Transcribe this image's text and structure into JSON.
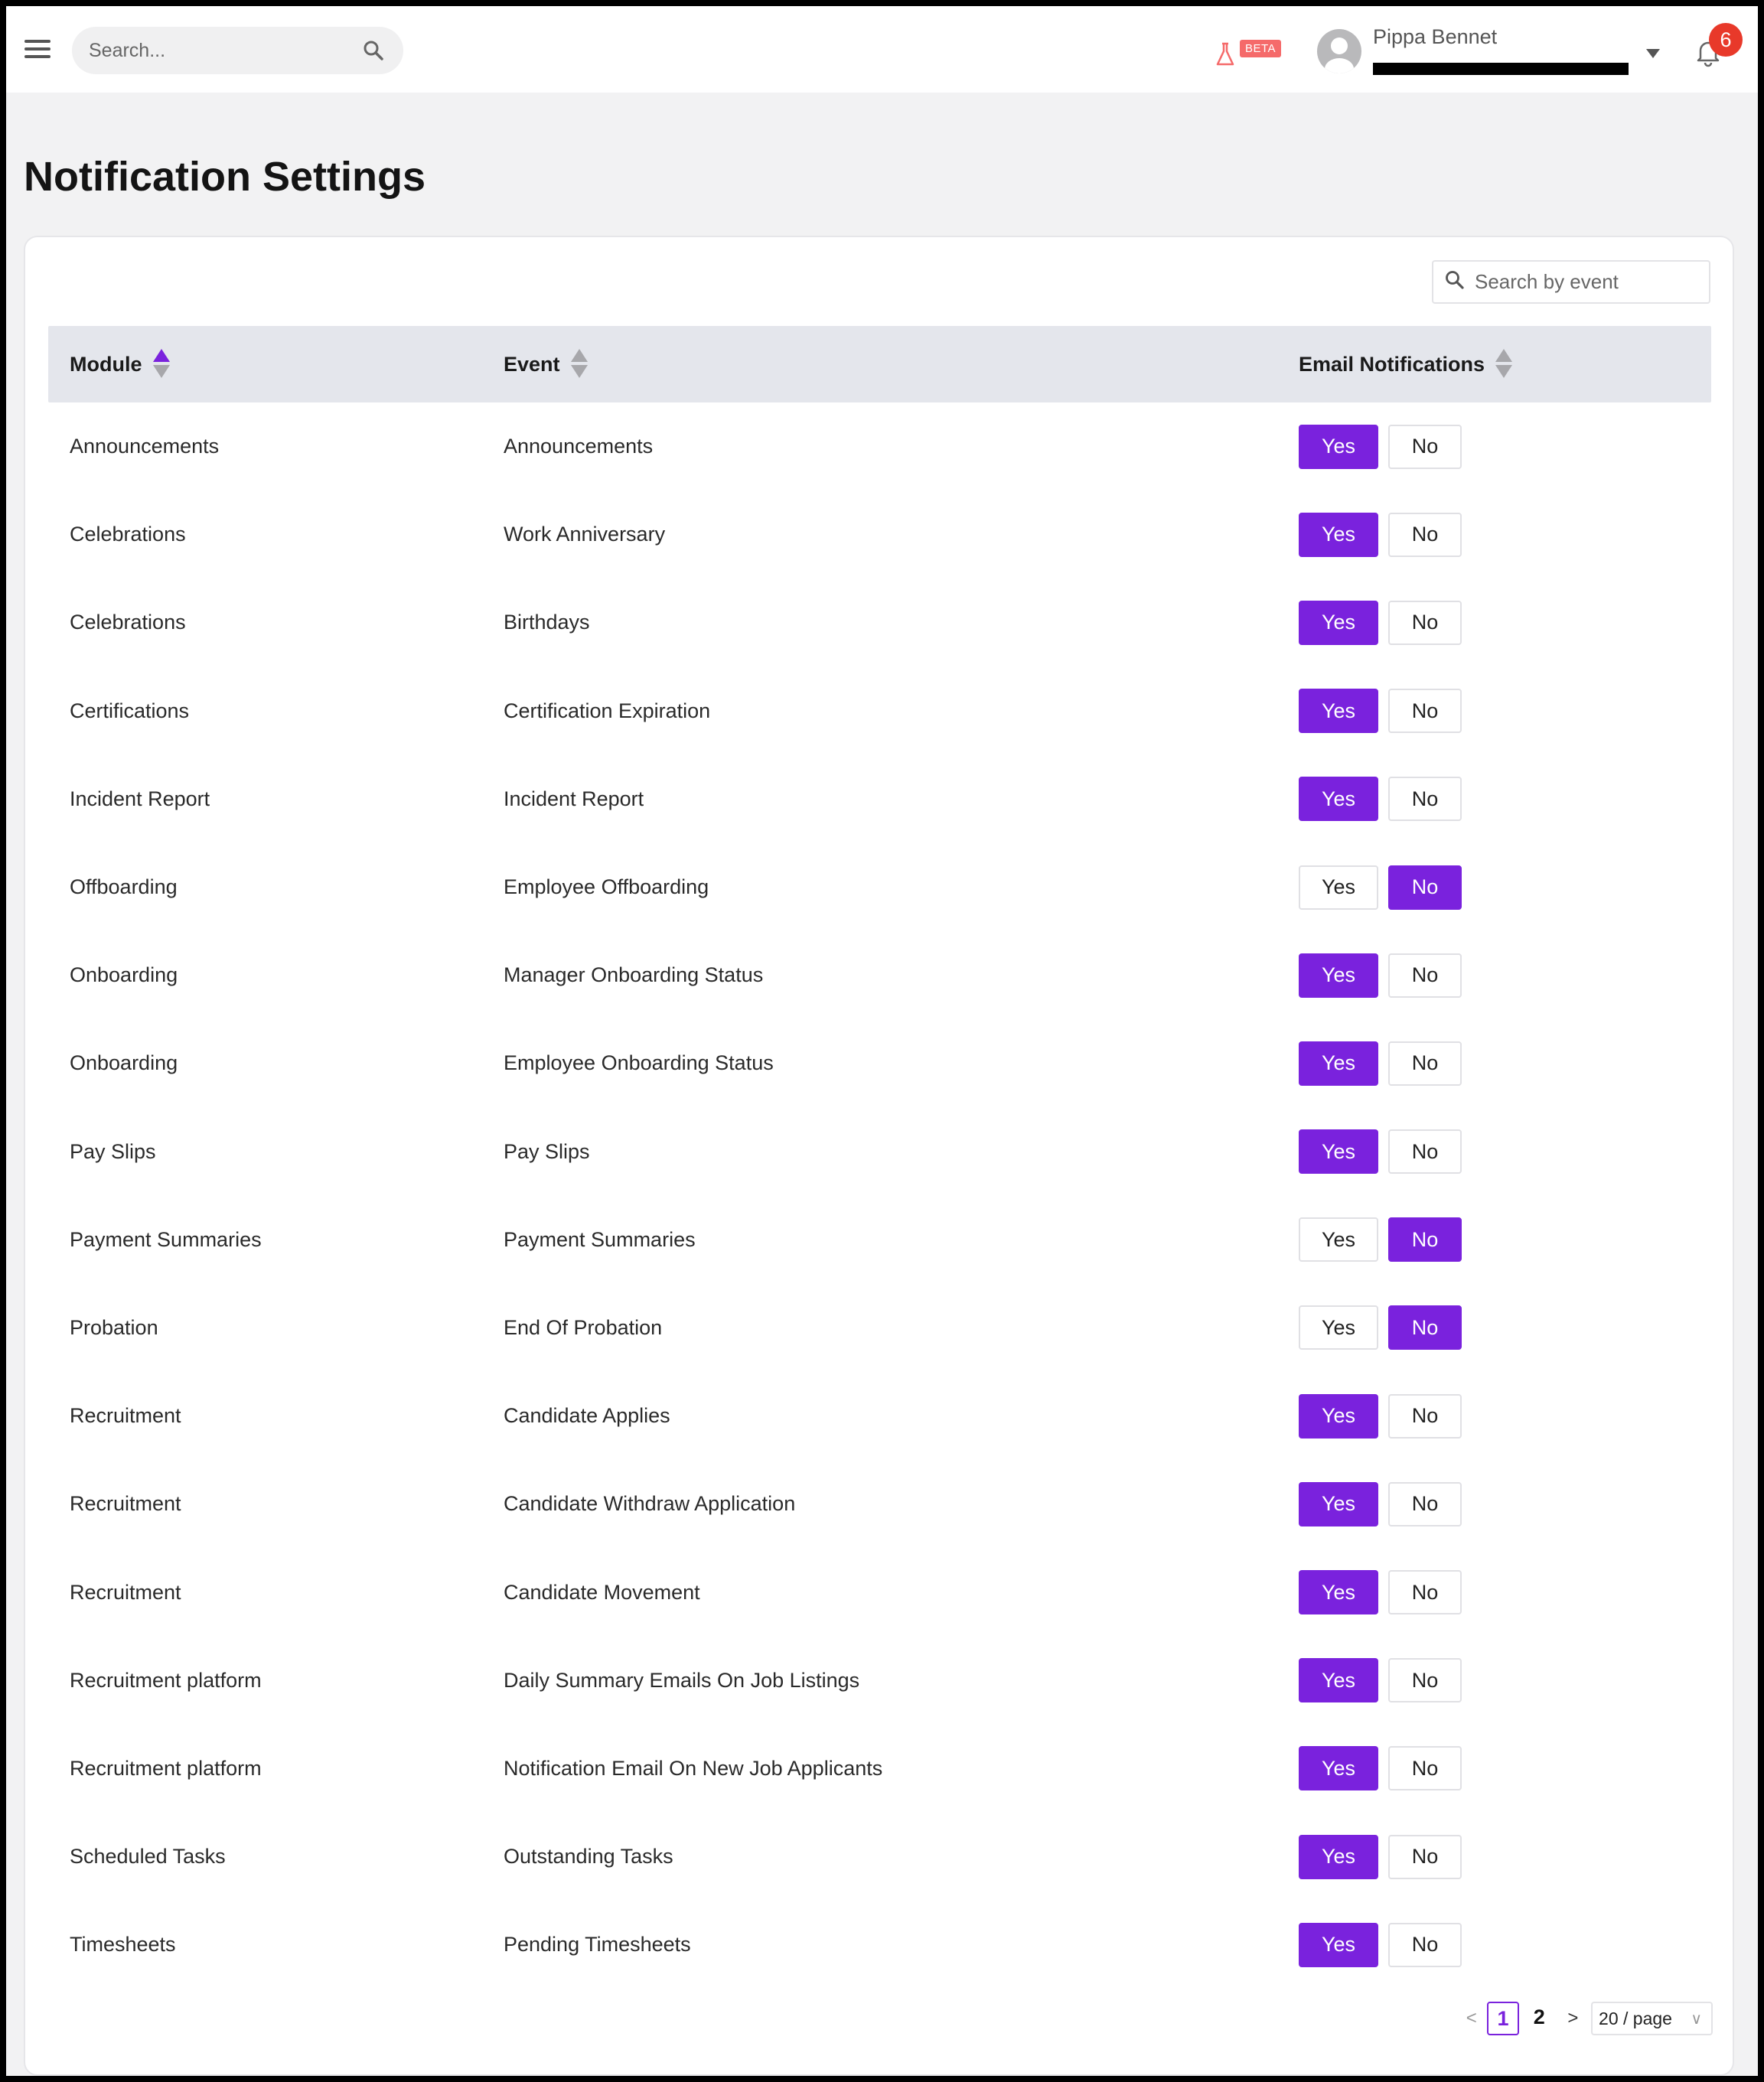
{
  "header": {
    "search_placeholder": "Search...",
    "beta_label": "BETA",
    "user_name": "Pippa Bennet",
    "notification_count": "6"
  },
  "page": {
    "title": "Notification Settings",
    "event_search_placeholder": "Search by event"
  },
  "table": {
    "columns": [
      "Module",
      "Event",
      "Email Notifications"
    ],
    "yes_label": "Yes",
    "no_label": "No",
    "rows": [
      {
        "module": "Announcements",
        "event": "Announcements",
        "email": "Yes"
      },
      {
        "module": "Celebrations",
        "event": "Work Anniversary",
        "email": "Yes"
      },
      {
        "module": "Celebrations",
        "event": "Birthdays",
        "email": "Yes"
      },
      {
        "module": "Certifications",
        "event": "Certification Expiration",
        "email": "Yes"
      },
      {
        "module": "Incident Report",
        "event": "Incident Report",
        "email": "Yes"
      },
      {
        "module": "Offboarding",
        "event": "Employee Offboarding",
        "email": "No"
      },
      {
        "module": "Onboarding",
        "event": "Manager Onboarding Status",
        "email": "Yes"
      },
      {
        "module": "Onboarding",
        "event": "Employee Onboarding Status",
        "email": "Yes"
      },
      {
        "module": "Pay Slips",
        "event": "Pay Slips",
        "email": "Yes"
      },
      {
        "module": "Payment Summaries",
        "event": "Payment Summaries",
        "email": "No"
      },
      {
        "module": "Probation",
        "event": "End Of Probation",
        "email": "No"
      },
      {
        "module": "Recruitment",
        "event": "Candidate Applies",
        "email": "Yes"
      },
      {
        "module": "Recruitment",
        "event": "Candidate Withdraw Application",
        "email": "Yes"
      },
      {
        "module": "Recruitment",
        "event": "Candidate Movement",
        "email": "Yes"
      },
      {
        "module": "Recruitment platform",
        "event": "Daily Summary Emails On Job Listings",
        "email": "Yes"
      },
      {
        "module": "Recruitment platform",
        "event": "Notification Email On New Job Applicants",
        "email": "Yes"
      },
      {
        "module": "Scheduled Tasks",
        "event": "Outstanding Tasks",
        "email": "Yes"
      },
      {
        "module": "Timesheets",
        "event": "Pending Timesheets",
        "email": "Yes"
      }
    ]
  },
  "pagination": {
    "prev": "<",
    "pages": [
      "1",
      "2"
    ],
    "current_page": "1",
    "next": ">",
    "page_size": "20 / page"
  },
  "colors": {
    "accent": "#7a22dd",
    "badge": "#e8392a",
    "beta": "#f56a6a",
    "header_bg": "#e4e6ec"
  }
}
